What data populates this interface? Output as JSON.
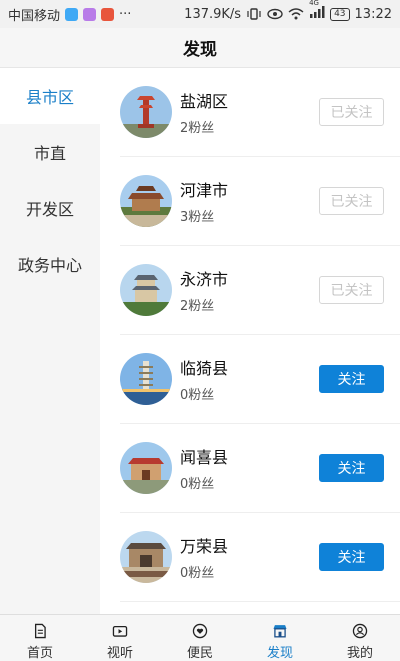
{
  "status_bar": {
    "carrier": "中国移动",
    "dots": "···",
    "speed": "137.9K/s",
    "network": "4G",
    "battery": "43",
    "time": "13:22"
  },
  "header": {
    "title": "发现"
  },
  "sidebar": {
    "items": [
      {
        "label": "县市区",
        "active": true
      },
      {
        "label": "市直",
        "active": false
      },
      {
        "label": "开发区",
        "active": false
      },
      {
        "label": "政务中心",
        "active": false
      }
    ]
  },
  "list": {
    "items": [
      {
        "name": "盐湖区",
        "fans": "2粉丝",
        "button": "已关注",
        "followed": true,
        "avatar": "tower-icon"
      },
      {
        "name": "河津市",
        "fans": "3粉丝",
        "button": "已关注",
        "followed": true,
        "avatar": "temple-icon"
      },
      {
        "name": "永济市",
        "fans": "2粉丝",
        "button": "已关注",
        "followed": true,
        "avatar": "pavilion-icon"
      },
      {
        "name": "临猗县",
        "fans": "0粉丝",
        "button": "关注",
        "followed": false,
        "avatar": "pagoda-icon"
      },
      {
        "name": "闻喜县",
        "fans": "0粉丝",
        "button": "关注",
        "followed": false,
        "avatar": "building-icon"
      },
      {
        "name": "万荣县",
        "fans": "0粉丝",
        "button": "关注",
        "followed": false,
        "avatar": "gate-icon"
      }
    ]
  },
  "bottom_nav": {
    "items": [
      {
        "label": "首页",
        "icon": "document-icon",
        "active": false
      },
      {
        "label": "视听",
        "icon": "video-icon",
        "active": false
      },
      {
        "label": "便民",
        "icon": "heart-icon",
        "active": false
      },
      {
        "label": "发现",
        "icon": "store-icon",
        "active": true
      },
      {
        "label": "我的",
        "icon": "user-icon",
        "active": false
      }
    ]
  },
  "colors": {
    "accent": "#1a7fc8",
    "follow_button": "#0f82d8",
    "followed_border": "#d6d6d6"
  }
}
